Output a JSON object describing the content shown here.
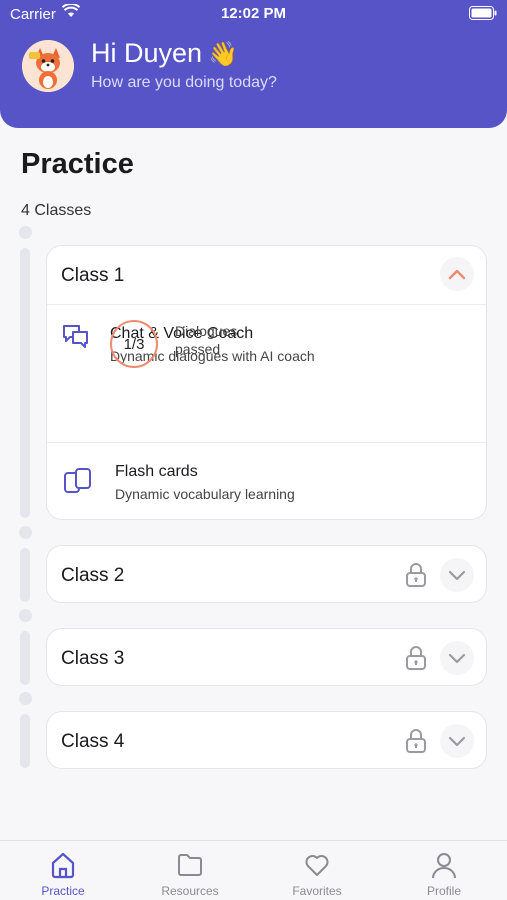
{
  "status_bar": {
    "carrier": "Carrier",
    "time": "12:02 PM"
  },
  "header": {
    "greeting": "Hi Duyen",
    "wave_emoji": "👋",
    "subtitle": "How are you doing today?",
    "avatar_icon": "fox-mascot"
  },
  "practice": {
    "title": "Practice",
    "class_count": "4 Classes"
  },
  "classes": [
    {
      "label": "Class 1",
      "expanded": true,
      "locked": false,
      "items": [
        {
          "icon": "chat-bubbles-icon",
          "title": "Chat & Voice Coach",
          "subtitle": "Dynamic dialogues with AI coach",
          "progress": "1/3",
          "progress_label_1": "Dialogues",
          "progress_label_2": "passed"
        },
        {
          "icon": "flash-cards-icon",
          "title": "Flash cards",
          "subtitle": "Dynamic vocabulary learning"
        }
      ]
    },
    {
      "label": "Class 2",
      "expanded": false,
      "locked": true
    },
    {
      "label": "Class 3",
      "expanded": false,
      "locked": true
    },
    {
      "label": "Class 4",
      "expanded": false,
      "locked": true
    }
  ],
  "tabs": [
    {
      "label": "Practice",
      "icon": "home-icon",
      "active": true
    },
    {
      "label": "Resources",
      "icon": "folder-icon",
      "active": false
    },
    {
      "label": "Favorites",
      "icon": "heart-icon",
      "active": false
    },
    {
      "label": "Profile",
      "icon": "person-icon",
      "active": false
    }
  ],
  "colors": {
    "brand": "#5654C7",
    "accent": "#EE8B6F"
  }
}
